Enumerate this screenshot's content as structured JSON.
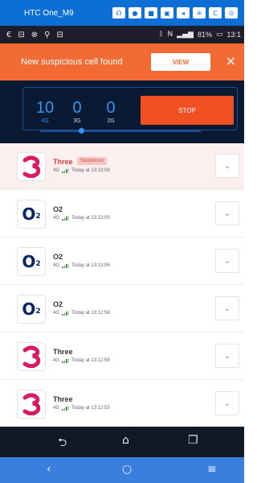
{
  "viewer": {
    "title": "HTC One_M9",
    "tools": [
      "☊",
      "●",
      "■",
      "▣",
      "◂",
      "⁜",
      "C",
      "⊙"
    ]
  },
  "status": {
    "left_icons": [
      "€",
      "⊟",
      "⊗",
      "⚲",
      "⊟"
    ],
    "battery": "81%",
    "time": "13:1"
  },
  "alert": {
    "message": "New suspicious cell found",
    "view_label": "VIEW",
    "close_label": "×"
  },
  "dashboard": {
    "counters": [
      {
        "value": "10",
        "label": "4G"
      },
      {
        "value": "0",
        "label": "3G"
      },
      {
        "value": "0",
        "label": "2G"
      }
    ],
    "stop_label": "STOP",
    "colors": {
      "accent": "#2f95f4",
      "stop": "#f05022"
    }
  },
  "cells": [
    {
      "operator": "Three",
      "logo": "three",
      "badge": "Suspicious",
      "network": "4G",
      "time": "Today at 13:13:08"
    },
    {
      "operator": "O2",
      "logo": "o2",
      "badge": "",
      "network": "4G",
      "time": "Today at 13:13:09"
    },
    {
      "operator": "O2",
      "logo": "o2",
      "badge": "",
      "network": "4G",
      "time": "Today at 13:13:06"
    },
    {
      "operator": "O2",
      "logo": "o2",
      "badge": "",
      "network": "4G",
      "time": "Today at 13:12:58"
    },
    {
      "operator": "Three",
      "logo": "three",
      "badge": "",
      "network": "4G",
      "time": "Today at 13:12:58"
    },
    {
      "operator": "Three",
      "logo": "three",
      "badge": "",
      "network": "4G",
      "time": "Today at 13:12:53"
    }
  ],
  "icons": {
    "expand": "chevron-down-icon",
    "android_nav": [
      "back-icon",
      "home-icon",
      "recents-icon"
    ],
    "viewer_nav": [
      "back-icon",
      "home-icon",
      "menu-icon"
    ]
  },
  "nav_glyphs": {
    "back": "⮌",
    "home": "⌂",
    "recent": "❐",
    "v_back": "‹",
    "v_home": "○",
    "v_menu": "≡"
  }
}
